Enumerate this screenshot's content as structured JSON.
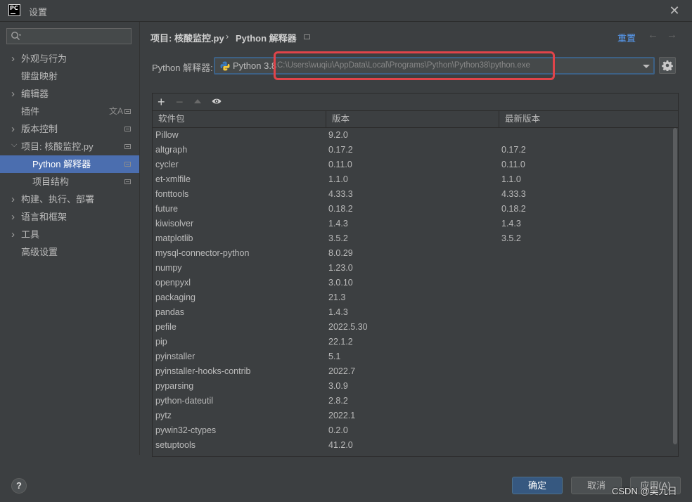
{
  "window": {
    "title": "设置",
    "app_logo": "PC"
  },
  "sidebar": {
    "search_placeholder": "",
    "items": [
      {
        "label": "外观与行为",
        "expandable": true,
        "badge": false
      },
      {
        "label": "键盘映射",
        "expandable": false,
        "badge": false
      },
      {
        "label": "编辑器",
        "expandable": true,
        "badge": false
      },
      {
        "label": "插件",
        "expandable": false,
        "badge": true,
        "translate": "文A"
      },
      {
        "label": "版本控制",
        "expandable": true,
        "badge": true
      },
      {
        "label": "项目: 核酸监控.py",
        "expandable": true,
        "expanded": true,
        "badge": true
      },
      {
        "label": "Python 解释器",
        "child": true,
        "selected": true,
        "badge": true
      },
      {
        "label": "项目结构",
        "child": true,
        "badge": true
      },
      {
        "label": "构建、执行、部署",
        "expandable": true,
        "badge": false
      },
      {
        "label": "语言和框架",
        "expandable": true,
        "badge": false
      },
      {
        "label": "工具",
        "expandable": true,
        "badge": false
      },
      {
        "label": "高级设置",
        "expandable": false,
        "badge": false
      }
    ]
  },
  "header": {
    "breadcrumb_root": "项目: 核酸监控.py",
    "breadcrumb_sep": "›",
    "breadcrumb_current": "Python 解释器",
    "reset": "重置"
  },
  "interpreter": {
    "label": "Python 解释器:",
    "name": "Python 3.8",
    "path": "C:\\Users\\wuqiu\\AppData\\Local\\Programs\\Python\\Python38\\python.exe"
  },
  "table": {
    "toolbar": {
      "add": "+",
      "remove": "−"
    },
    "columns": [
      "软件包",
      "版本",
      "最新版本"
    ],
    "rows": [
      [
        "Pillow",
        "9.2.0",
        ""
      ],
      [
        "altgraph",
        "0.17.2",
        "0.17.2"
      ],
      [
        "cycler",
        "0.11.0",
        "0.11.0"
      ],
      [
        "et-xmlfile",
        "1.1.0",
        "1.1.0"
      ],
      [
        "fonttools",
        "4.33.3",
        "4.33.3"
      ],
      [
        "future",
        "0.18.2",
        "0.18.2"
      ],
      [
        "kiwisolver",
        "1.4.3",
        "1.4.3"
      ],
      [
        "matplotlib",
        "3.5.2",
        "3.5.2"
      ],
      [
        "mysql-connector-python",
        "8.0.29",
        ""
      ],
      [
        "numpy",
        "1.23.0",
        ""
      ],
      [
        "openpyxl",
        "3.0.10",
        ""
      ],
      [
        "packaging",
        "21.3",
        ""
      ],
      [
        "pandas",
        "1.4.3",
        ""
      ],
      [
        "pefile",
        "2022.5.30",
        ""
      ],
      [
        "pip",
        "22.1.2",
        ""
      ],
      [
        "pyinstaller",
        "5.1",
        ""
      ],
      [
        "pyinstaller-hooks-contrib",
        "2022.7",
        ""
      ],
      [
        "pyparsing",
        "3.0.9",
        ""
      ],
      [
        "python-dateutil",
        "2.8.2",
        ""
      ],
      [
        "pytz",
        "2022.1",
        ""
      ],
      [
        "pywin32-ctypes",
        "0.2.0",
        ""
      ],
      [
        "setuptools",
        "41.2.0",
        ""
      ]
    ]
  },
  "footer": {
    "help": "?",
    "ok": "确定",
    "cancel": "取消",
    "apply": "应用(A)",
    "watermark": "CSDN @吴九日"
  },
  "colors": {
    "accent": "#4b6eaf",
    "link": "#589df6",
    "highlight": "#e0444a",
    "background": "#3c3f41"
  },
  "icons": [
    "search-icon",
    "close-icon",
    "python-logo-icon",
    "gear-icon",
    "add-icon",
    "remove-icon",
    "move-up-icon",
    "eye-icon",
    "help-icon",
    "back-arrow-icon",
    "forward-arrow-icon"
  ]
}
